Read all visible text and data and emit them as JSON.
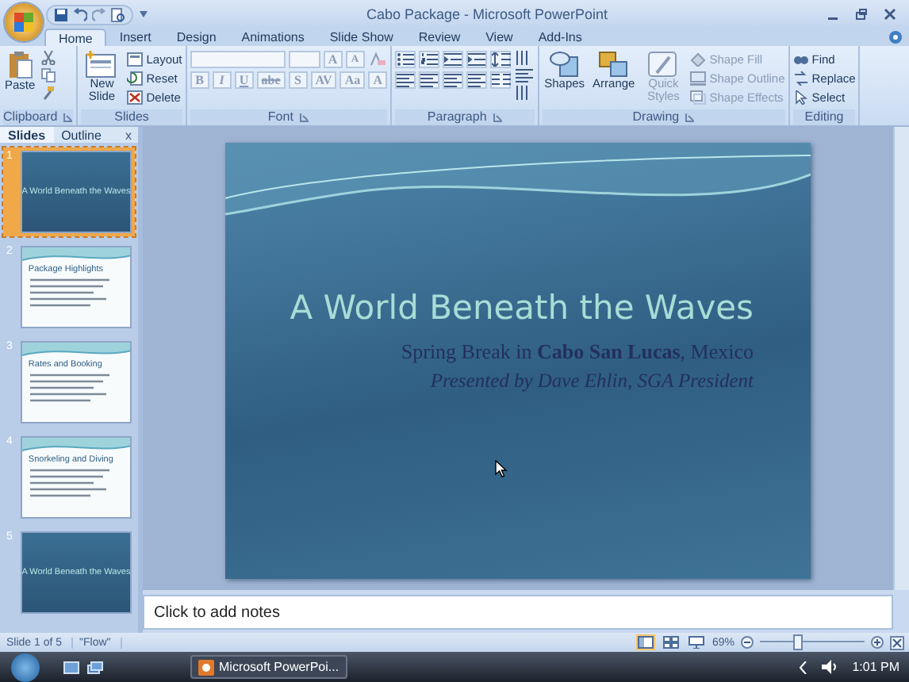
{
  "window": {
    "title": "Cabo Package - Microsoft PowerPoint"
  },
  "ribbon_tabs": [
    {
      "label": "Home",
      "selected": true
    },
    {
      "label": "Insert",
      "selected": false
    },
    {
      "label": "Design",
      "selected": false
    },
    {
      "label": "Animations",
      "selected": false
    },
    {
      "label": "Slide Show",
      "selected": false
    },
    {
      "label": "Review",
      "selected": false
    },
    {
      "label": "View",
      "selected": false
    },
    {
      "label": "Add-Ins",
      "selected": false
    }
  ],
  "ribbon": {
    "clipboard": {
      "label": "Clipboard",
      "paste": "Paste"
    },
    "slides": {
      "label": "Slides",
      "new_slide": "New Slide",
      "commands": [
        "Layout",
        "Reset",
        "Delete"
      ]
    },
    "font": {
      "label": "Font",
      "disabled": true,
      "size_buttons": [
        "A",
        "A"
      ],
      "buttons": [
        "B",
        "I",
        "U",
        "abe",
        "S",
        "AV",
        "Aa",
        "A"
      ]
    },
    "paragraph": {
      "label": "Paragraph"
    },
    "drawing": {
      "label": "Drawing",
      "large": [
        {
          "label": "Shapes",
          "disabled": false
        },
        {
          "label": "Arrange",
          "disabled": false
        },
        {
          "label": "Quick Styles",
          "disabled": true
        }
      ],
      "commands": [
        {
          "label": "Shape Fill",
          "disabled": true
        },
        {
          "label": "Shape Outline",
          "disabled": true
        },
        {
          "label": "Shape Effects",
          "disabled": true
        }
      ]
    },
    "editing": {
      "label": "Editing",
      "commands": [
        "Find",
        "Replace",
        "Select"
      ]
    }
  },
  "pane_tabs": [
    {
      "label": "Slides",
      "selected": true
    },
    {
      "label": "Outline",
      "selected": false
    }
  ],
  "pane_close": "x",
  "thumbnails": [
    {
      "number": "1",
      "kind": "title",
      "title": "A World Beneath the Waves",
      "selected": true
    },
    {
      "number": "2",
      "kind": "content",
      "title": "Package Highlights",
      "selected": false
    },
    {
      "number": "3",
      "kind": "content",
      "title": "Rates and Booking",
      "selected": false
    },
    {
      "number": "4",
      "kind": "content",
      "title": "Snorkeling and Diving",
      "selected": false
    },
    {
      "number": "5",
      "kind": "title",
      "title": "A World Beneath the Waves",
      "selected": false
    }
  ],
  "slide": {
    "title": "A World Beneath the Waves",
    "subtitle": "Spring Break in **Cabo San Lucas**, Mexico",
    "presenter": "Presented by Dave Ehlin, SGA President"
  },
  "notes": {
    "placeholder": "Click to add notes"
  },
  "status_bar": {
    "slide_info": "Slide 1 of 5",
    "theme": "\"Flow\"",
    "views": [
      {
        "kind": "normal",
        "selected": true
      },
      {
        "kind": "sorter",
        "selected": false
      },
      {
        "kind": "show",
        "selected": false
      }
    ],
    "zoom": "69%",
    "zoom_slider": {
      "level": 0.37
    }
  },
  "taskbar": {
    "app": "Microsoft PowerPoi...",
    "time": "1:01 PM"
  }
}
